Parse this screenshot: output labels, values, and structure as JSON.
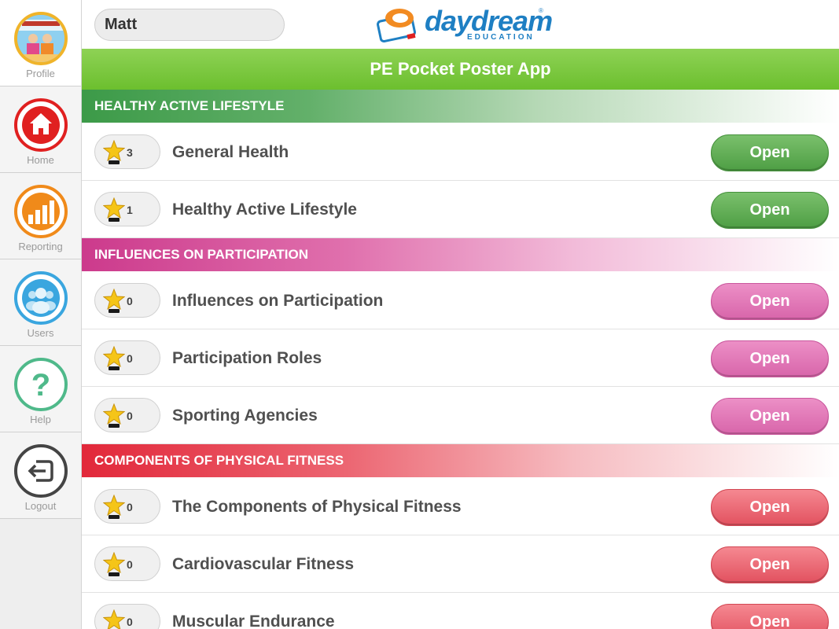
{
  "user": {
    "name": "Matt"
  },
  "logo": {
    "word": "daydream",
    "sub": "EDUCATION",
    "reg": "®"
  },
  "app_title": "PE Pocket Poster App",
  "sidebar": {
    "items": [
      {
        "label": "Profile",
        "icon": "profile-photo"
      },
      {
        "label": "Home",
        "icon": "home-icon"
      },
      {
        "label": "Reporting",
        "icon": "bar-chart-icon"
      },
      {
        "label": "Users",
        "icon": "users-icon"
      },
      {
        "label": "Help",
        "icon": "question-mark-icon"
      },
      {
        "label": "Logout",
        "icon": "logout-icon"
      }
    ]
  },
  "sections": [
    {
      "title": "HEALTHY ACTIVE LIFESTYLE",
      "color": "#3f9a4a",
      "rows": [
        {
          "topic": "General Health",
          "stars": "3",
          "button": "Open"
        },
        {
          "topic": "Healthy Active Lifestyle",
          "stars": "1",
          "button": "Open"
        }
      ]
    },
    {
      "title": "INFLUENCES ON PARTICIPATION",
      "color": "#cf3d90",
      "rows": [
        {
          "topic": "Influences on Participation",
          "stars": "0",
          "button": "Open"
        },
        {
          "topic": "Participation Roles",
          "stars": "0",
          "button": "Open"
        },
        {
          "topic": "Sporting Agencies",
          "stars": "0",
          "button": "Open"
        }
      ]
    },
    {
      "title": "COMPONENTS OF PHYSICAL FITNESS",
      "color": "#e32b3c",
      "rows": [
        {
          "topic": "The Components of Physical Fitness",
          "stars": "0",
          "button": "Open"
        },
        {
          "topic": "Cardiovascular Fitness",
          "stars": "0",
          "button": "Open"
        },
        {
          "topic": "Muscular Endurance",
          "stars": "0",
          "button": "Open"
        }
      ]
    }
  ]
}
